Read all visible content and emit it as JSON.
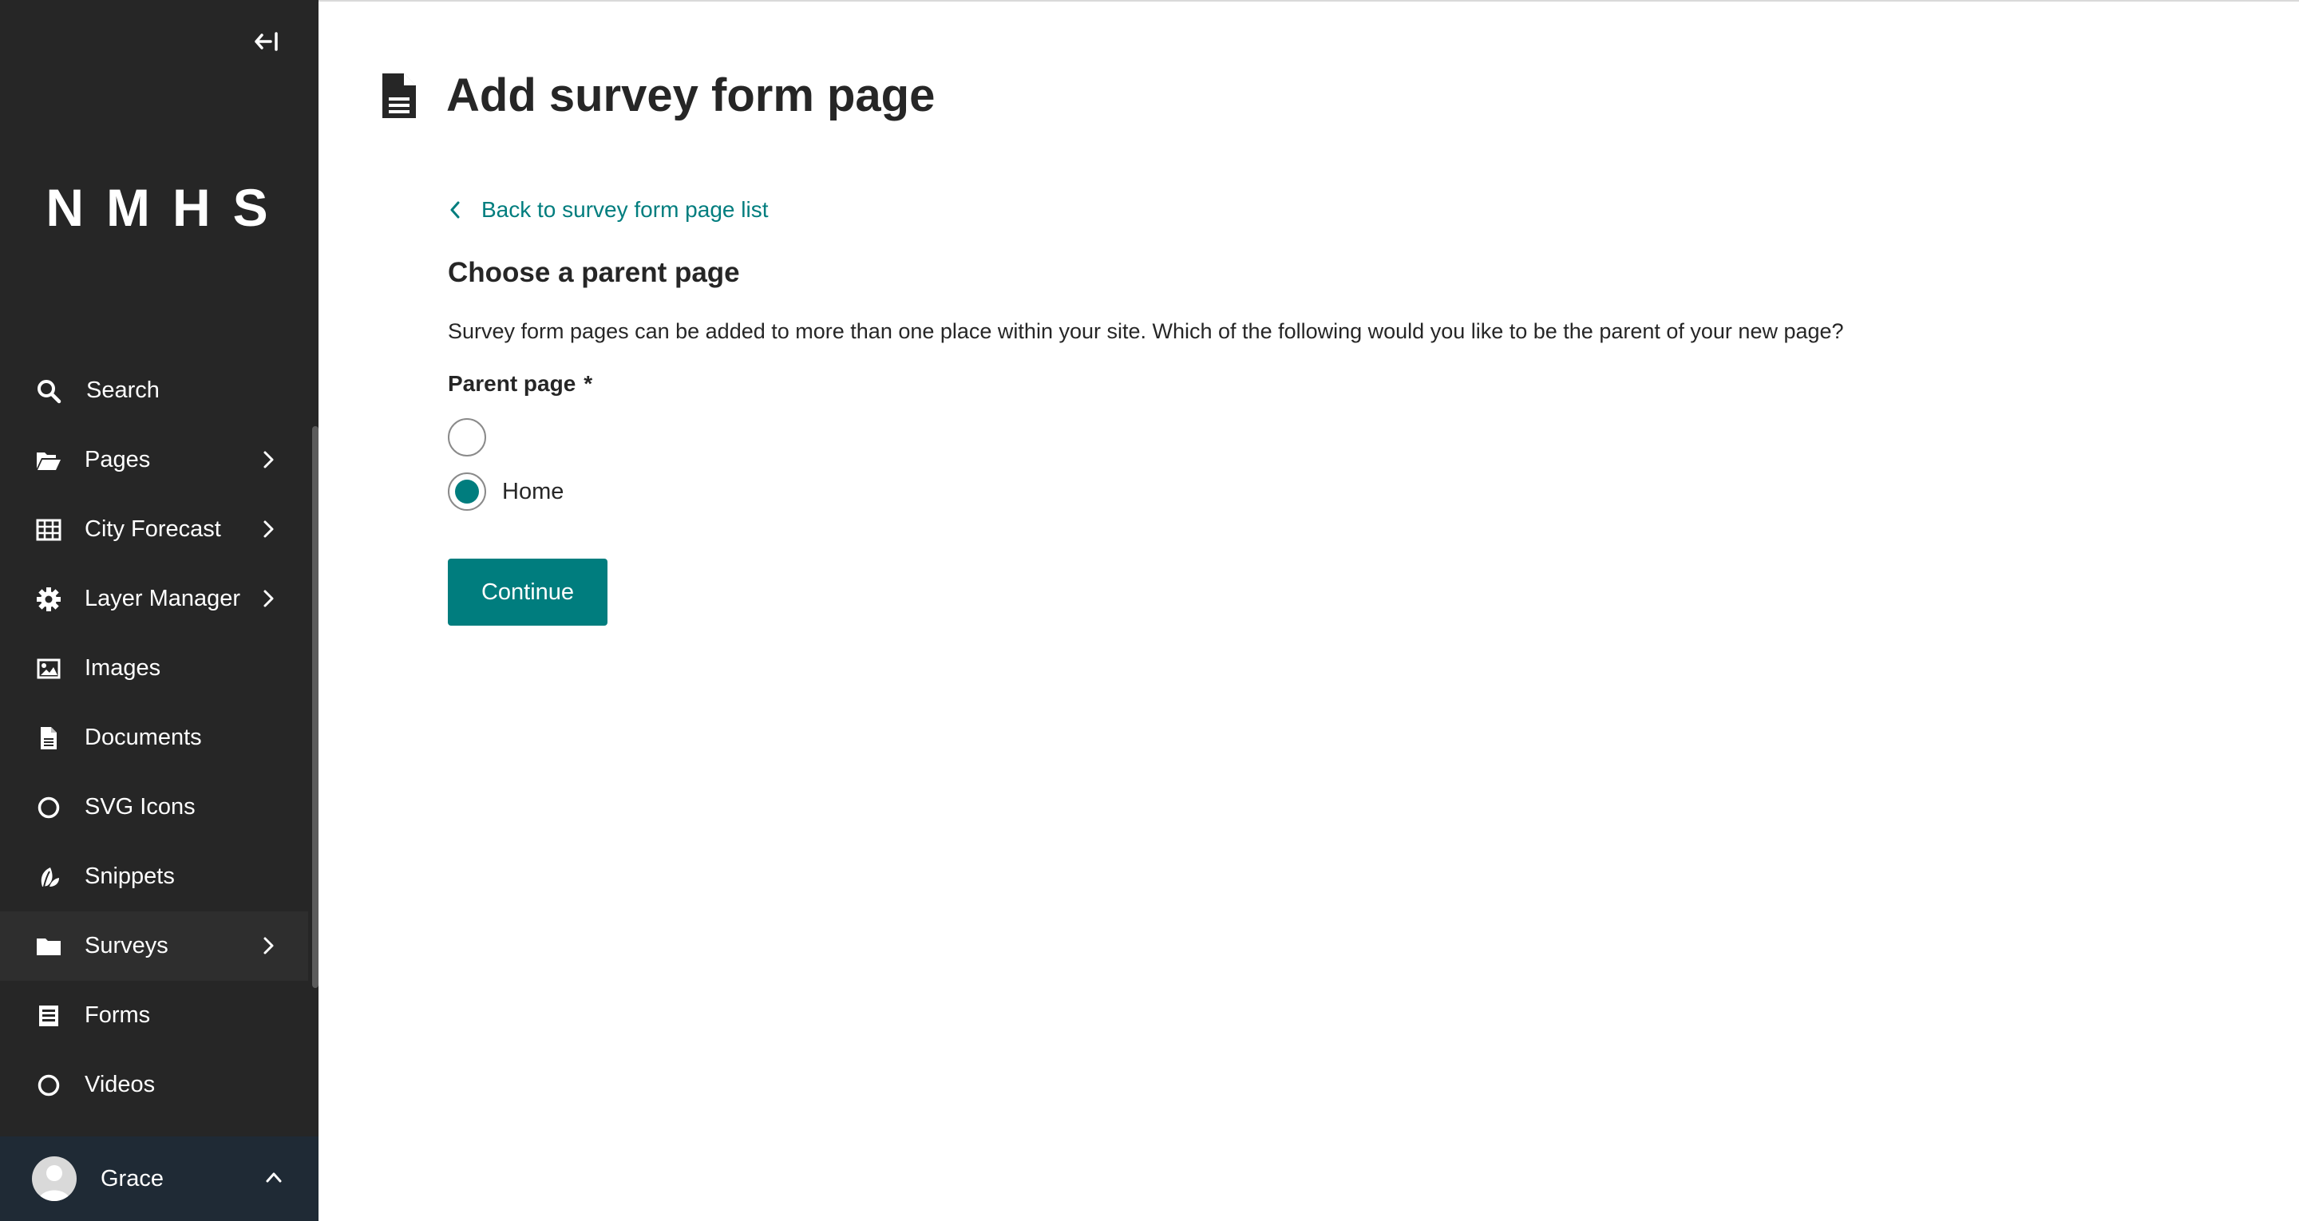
{
  "sidebar": {
    "logo": "NMHS",
    "items": [
      {
        "id": "search",
        "label": "Search",
        "icon": "search-icon",
        "has_submenu": false
      },
      {
        "id": "pages",
        "label": "Pages",
        "icon": "folder-open-icon",
        "has_submenu": true
      },
      {
        "id": "city-forecast",
        "label": "City Forecast",
        "icon": "table-icon",
        "has_submenu": true
      },
      {
        "id": "layer-manager",
        "label": "Layer Manager",
        "icon": "gear-icon",
        "has_submenu": true
      },
      {
        "id": "images",
        "label": "Images",
        "icon": "image-icon",
        "has_submenu": false
      },
      {
        "id": "documents",
        "label": "Documents",
        "icon": "document-icon",
        "has_submenu": false
      },
      {
        "id": "svg-icons",
        "label": "SVG Icons",
        "icon": "circle-icon",
        "has_submenu": false
      },
      {
        "id": "snippets",
        "label": "Snippets",
        "icon": "leaf-icon",
        "has_submenu": false
      },
      {
        "id": "surveys",
        "label": "Surveys",
        "icon": "folder-icon",
        "has_submenu": true
      },
      {
        "id": "forms",
        "label": "Forms",
        "icon": "form-icon",
        "has_submenu": false
      },
      {
        "id": "videos",
        "label": "Videos",
        "icon": "circle-icon",
        "has_submenu": false
      }
    ],
    "account": {
      "name": "Grace"
    }
  },
  "header": {
    "title": "Add survey form page"
  },
  "main": {
    "back_link": "Back to survey form page list",
    "section_title": "Choose a parent page",
    "help_text": "Survey form pages can be added to more than one place within your site. Which of the following would you like to be the parent of your new page?",
    "field_label": "Parent page",
    "required_marker": "*",
    "options": [
      {
        "label": "",
        "selected": false
      },
      {
        "label": "Home",
        "selected": true
      }
    ],
    "continue_label": "Continue"
  },
  "colors": {
    "sidebar_bg": "#262626",
    "accent": "#007d7e",
    "account_bg": "#1f2a35"
  }
}
